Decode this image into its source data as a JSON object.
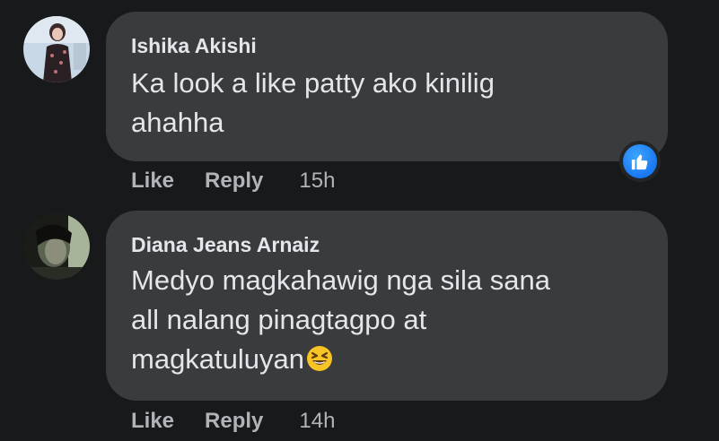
{
  "comments": [
    {
      "author": "Ishika Akishi",
      "text": "Ka look a like patty ako kinilig\nahahha",
      "actions": {
        "like": "Like",
        "reply": "Reply",
        "time": "15h"
      },
      "reaction_icon": "thumbs-up-icon",
      "avatar_colors": [
        "#c9d8e6",
        "#3a2a2a",
        "#e9c7b8"
      ]
    },
    {
      "author": "Diana Jeans Arnaiz",
      "text": "Medyo magkahawig nga sila sana\nall nalang pinagtagpo at\nmagkatuluyan",
      "emoji": "grinning-squinting-face-icon",
      "actions": {
        "like": "Like",
        "reply": "Reply",
        "time": "14h"
      },
      "avatar_colors": [
        "#1a1c18",
        "#a8b49a",
        "#5a6250"
      ]
    }
  ],
  "colors": {
    "background": "#18191a",
    "bubble": "#3a3b3c",
    "text": "#e4e6eb",
    "secondary": "#b0b3b8",
    "like_blue": "#1877f2"
  }
}
